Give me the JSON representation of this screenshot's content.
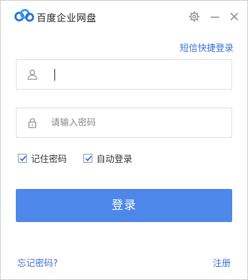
{
  "app": {
    "title": "百度企业网盘"
  },
  "links": {
    "sms_login": "短信快捷登录",
    "forgot_password": "忘记密码?",
    "register": "注册"
  },
  "form": {
    "username": {
      "value": "",
      "placeholder": ""
    },
    "password": {
      "value": "",
      "placeholder": "请输入密码"
    }
  },
  "options": {
    "remember_password": {
      "label": "记住密码",
      "checked": true
    },
    "auto_login": {
      "label": "自动登录",
      "checked": true
    }
  },
  "buttons": {
    "login_label": "登录"
  },
  "icons": [
    "baidu-netdisk-logo-icon",
    "settings-gear-icon",
    "minimize-icon",
    "close-icon",
    "user-icon",
    "lock-icon",
    "checkmark-icon"
  ],
  "colors": {
    "accent": "#4e87ea",
    "link": "#3a6fd8",
    "border": "#d9dce1"
  }
}
